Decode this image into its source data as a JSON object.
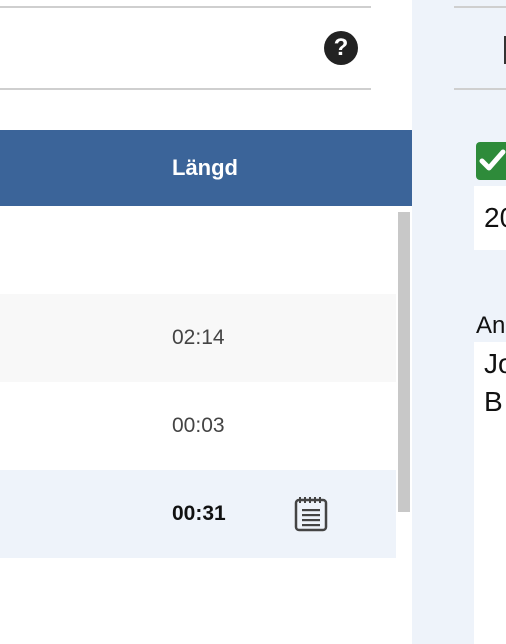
{
  "header": {
    "help_icon_glyph": "?"
  },
  "table": {
    "column_length_label": "Längd",
    "rows": [
      {
        "length": "02:14"
      },
      {
        "length": "00:03"
      },
      {
        "length": "00:31",
        "has_notes": true
      }
    ]
  },
  "sidebar": {
    "field_value_fragment": "20",
    "label_fragment": "An",
    "text_line1_fragment": "Jo",
    "text_line2_fragment": "B"
  },
  "colors": {
    "header_bg": "#3b6499",
    "row_alt_bg": "#f8f8f8",
    "row_selected_bg": "#eef3fa",
    "check_green": "#2e8b3a",
    "right_panel_bg": "#eef3fa"
  }
}
